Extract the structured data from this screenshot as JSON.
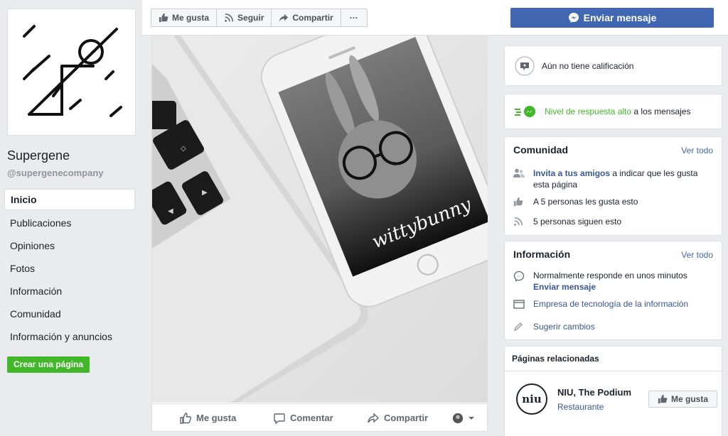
{
  "sidebar": {
    "page_name": "Supergene",
    "page_handle": "@supergenecompany",
    "nav": [
      {
        "label": "Inicio",
        "active": true
      },
      {
        "label": "Publicaciones"
      },
      {
        "label": "Opiniones"
      },
      {
        "label": "Fotos"
      },
      {
        "label": "Información"
      },
      {
        "label": "Comunidad"
      },
      {
        "label": "Información y anuncios"
      }
    ],
    "create_page": "Crear una página"
  },
  "action_bar": {
    "like": "Me gusta",
    "follow": "Seguir",
    "share": "Compartir",
    "more": "···",
    "send_message": "Enviar mensaje"
  },
  "post": {
    "phone_text": "wittybunny",
    "like": "Me gusta",
    "comment": "Comentar",
    "share": "Compartir"
  },
  "rating": {
    "text": "Aún no tiene calificación"
  },
  "response": {
    "highlight": "Nivel de respuesta alto",
    "rest": " a los mensajes"
  },
  "community": {
    "title": "Comunidad",
    "see_all": "Ver todo",
    "invite_link": "Invita a tus amigos",
    "invite_rest": " a indicar que les gusta esta página",
    "likes": "A 5 personas les gusta esto",
    "follows": "5 personas siguen esto"
  },
  "info": {
    "title": "Información",
    "see_all": "Ver todo",
    "response_time": "Normalmente responde en unos minutos",
    "send_message": "Enviar mensaje",
    "category": "Empresa de tecnología de la información",
    "suggest": "Sugerir cambios"
  },
  "related": {
    "title": "Páginas relacionadas",
    "items": [
      {
        "name": "NIU, The Podium",
        "category": "Restaurante",
        "logo_text": "niu",
        "like": "Me gusta"
      }
    ]
  },
  "colors": {
    "fb_blue": "#4267b2",
    "green": "#42b72a",
    "background": "#e9ebee"
  }
}
